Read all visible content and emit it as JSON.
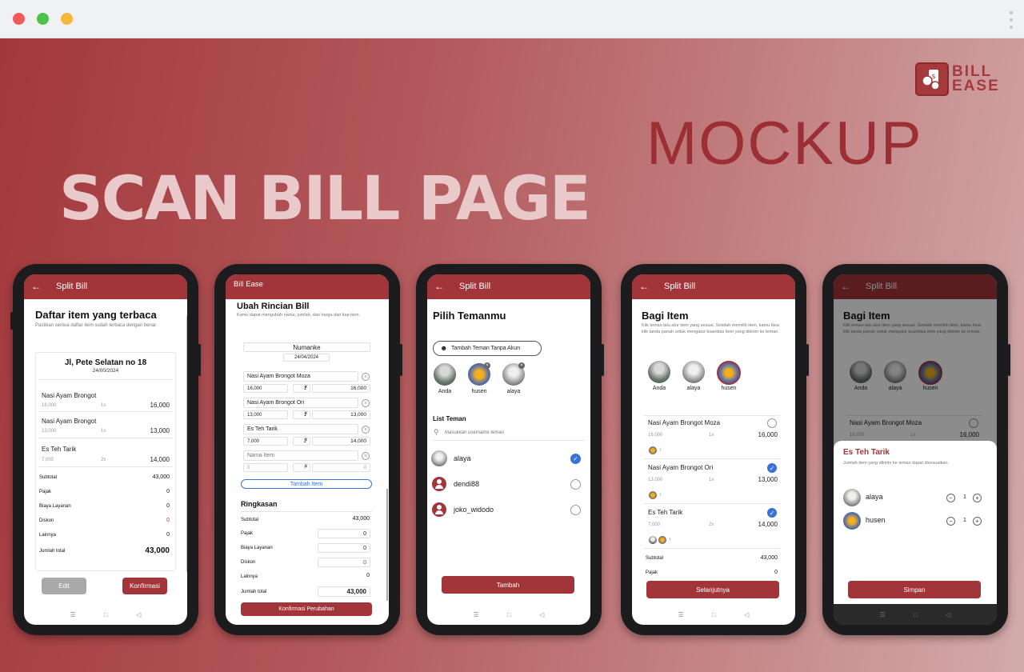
{
  "hero_title": "SCAN BILL PAGE",
  "mockup_label": "MOCKUP",
  "logo": {
    "line1": "BILL",
    "line2": "EASE"
  },
  "colors": {
    "brand": "#a2353a",
    "accent_blue": "#3b70d8"
  },
  "nav_icons": [
    "menu-icon",
    "home-square-icon",
    "back-triangle-icon"
  ],
  "screen1": {
    "appbar_title": "Split Bill",
    "heading": "Daftar item yang terbaca",
    "subtitle": "Pastikan semua daftar item sudah terbaca dengan benar.",
    "store_name": "Jl, Pete Selatan no 18",
    "date": "24/00/2024",
    "items": [
      {
        "name": "Nasi Ayam Brongot",
        "price": "16,000",
        "qty": "1x",
        "total": "16,000"
      },
      {
        "name": "Nasi Ayam Brongot",
        "price": "13,000",
        "qty": "1x",
        "total": "13,000"
      },
      {
        "name": "Es Teh Tarik",
        "price": "7,000",
        "qty": "2x",
        "total": "14,000"
      }
    ],
    "summary": [
      {
        "label": "Subtotal",
        "value": "43,000"
      },
      {
        "label": "Pajak",
        "value": "0"
      },
      {
        "label": "Biaya Layanan",
        "value": "0"
      },
      {
        "label": "Diskon",
        "value": "0"
      },
      {
        "label": "Lainnya",
        "value": "0"
      }
    ],
    "total_label": "Jumlah total",
    "total_value": "43,000",
    "edit_button": "Edit",
    "confirm_button": "Konfirmasi"
  },
  "screen2": {
    "appbar_title": "Bill Ease",
    "heading": "Ubah Rincian Bill",
    "subtitle": "Kamu dapat mengubah nama, jumlah, dan harga dari tiap item.",
    "store_name": "Numanke",
    "date": "24/04/2024",
    "items": [
      {
        "name": "Nasi Ayam Brongot Moza",
        "price": "16,000",
        "qty": "1",
        "total": "16,000"
      },
      {
        "name": "Nasi Ayam Brongot Ori",
        "price": "13,000",
        "qty": "1",
        "total": "13,000"
      },
      {
        "name": "Es Teh Tarik",
        "price": "7,000",
        "qty": "2",
        "total": "14,000"
      }
    ],
    "new_item": {
      "name_placeholder": "Nama Item",
      "price": "0",
      "qty": "0",
      "total": "0"
    },
    "add_item_button": "Tambah Item",
    "summary_title": "Ringkasan",
    "summary": [
      {
        "label": "Subtotal",
        "value": "43,000"
      },
      {
        "label": "Pajak",
        "value": "0"
      },
      {
        "label": "Biaya Layanan",
        "value": "0"
      },
      {
        "label": "Diskon",
        "value": "0"
      },
      {
        "label": "Lainnya",
        "value": "0"
      }
    ],
    "total_label": "Jumlah total",
    "total_value": "43,000",
    "confirm_button": "Konfirmasi Perubahan"
  },
  "screen3": {
    "appbar_title": "Split Bill",
    "heading": "Pilih Temanmu",
    "add_friend_button": "Tambah Teman Tanpa Akun",
    "selected": [
      "Anda",
      "husen",
      "alaya"
    ],
    "list_title": "List Teman",
    "search_placeholder": "Masukkan username teman",
    "friends": [
      {
        "name": "alaya",
        "checked": true
      },
      {
        "name": "dendi88",
        "checked": false
      },
      {
        "name": "joko_widodo",
        "checked": false
      }
    ],
    "add_button": "Tambah"
  },
  "screen4": {
    "appbar_title": "Split Bill",
    "heading": "Bagi Item",
    "subtitle": "Klik teman lalu atur item yang sesuai. Setelah memilih item, kamu bisa klik tanda panah untuk mengatur kuantitas item yang dikirim ke teman.",
    "people": [
      "Anda",
      "alaya",
      "husen"
    ],
    "items": [
      {
        "name": "Nasi Ayam Brongot Moza",
        "price": "16,000",
        "qty": "1x",
        "total": "16,000",
        "checked": false
      },
      {
        "name": "Nasi Ayam Brongot Ori",
        "price": "13,000",
        "qty": "1x",
        "total": "13,000",
        "checked": true
      },
      {
        "name": "Es Teh Tarik",
        "price": "7,000",
        "qty": "2x",
        "total": "14,000",
        "checked": true
      }
    ],
    "summary": [
      {
        "label": "Subtotal",
        "value": "43,000"
      },
      {
        "label": "Pajak",
        "value": "0"
      }
    ],
    "next_button": "Selanjutnya"
  },
  "screen5": {
    "appbar_title": "Split Bill",
    "heading": "Bagi Item",
    "subtitle": "Klik teman lalu atur item yang sesuai. Setelah memilih item, kamu bisa klik tanda panah untuk mengatur kuantitas item yang dikirim ke teman.",
    "people": [
      "Anda",
      "alaya",
      "husen"
    ],
    "bg_item": {
      "name": "Nasi Ayam Brongot Moza",
      "price": "16,000",
      "qty": "1x",
      "total": "16,000"
    },
    "sheet_title": "Es Teh Tarik",
    "sheet_subtitle": "Jumlah item yang dikirim ke teman dapat disesuaikan.",
    "assignments": [
      {
        "name": "alaya",
        "qty": "1"
      },
      {
        "name": "husen",
        "qty": "1"
      }
    ],
    "save_button": "Simpan"
  }
}
